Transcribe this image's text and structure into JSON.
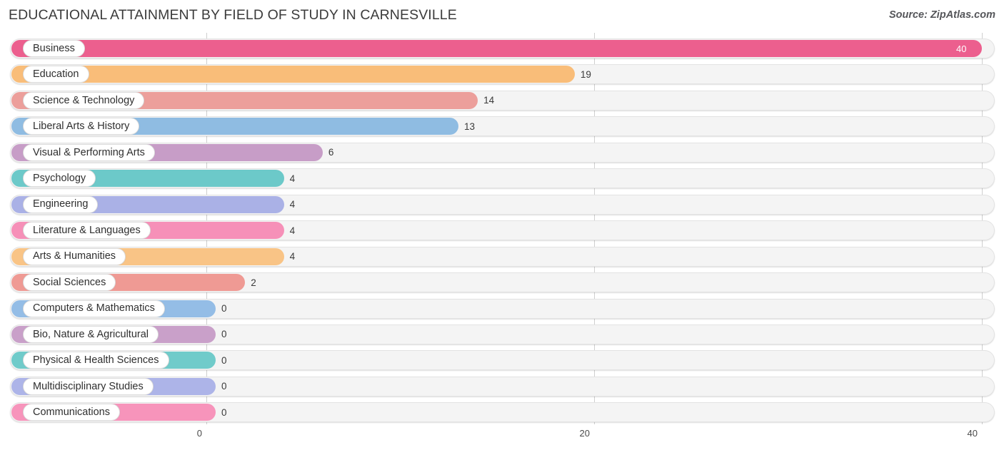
{
  "header": {
    "title": "EDUCATIONAL ATTAINMENT BY FIELD OF STUDY IN CARNESVILLE",
    "source": "Source: ZipAtlas.com"
  },
  "chart_data": {
    "type": "bar",
    "orientation": "horizontal",
    "title": "EDUCATIONAL ATTAINMENT BY FIELD OF STUDY IN CARNESVILLE",
    "xlabel": "",
    "ylabel": "",
    "xlim": [
      0,
      40
    ],
    "xticks": [
      "0",
      "20",
      "40"
    ],
    "xtick_values": [
      0,
      20,
      40
    ],
    "grid": true,
    "legend": false,
    "categories": [
      "Business",
      "Education",
      "Science & Technology",
      "Liberal Arts & History",
      "Visual & Performing Arts",
      "Psychology",
      "Engineering",
      "Literature & Languages",
      "Arts & Humanities",
      "Social Sciences",
      "Computers & Mathematics",
      "Bio, Nature & Agricultural",
      "Physical & Health Sciences",
      "Multidisciplinary Studies",
      "Communications"
    ],
    "values": [
      40,
      19,
      14,
      13,
      6,
      4,
      4,
      4,
      4,
      2,
      0,
      0,
      0,
      0,
      0
    ],
    "value_labels": [
      "40",
      "19",
      "14",
      "13",
      "6",
      "4",
      "4",
      "4",
      "4",
      "2",
      "0",
      "0",
      "0",
      "0",
      "0"
    ],
    "colors": [
      "#ec5f8e",
      "#f9bd79",
      "#ec9f9b",
      "#8fbce2",
      "#c79dc7",
      "#6cc9c9",
      "#aab1e6",
      "#f690b8",
      "#f9c486",
      "#ef9a94",
      "#94bde6",
      "#c9a0c9",
      "#70cbca",
      "#adb4e8",
      "#f794bb"
    ]
  }
}
